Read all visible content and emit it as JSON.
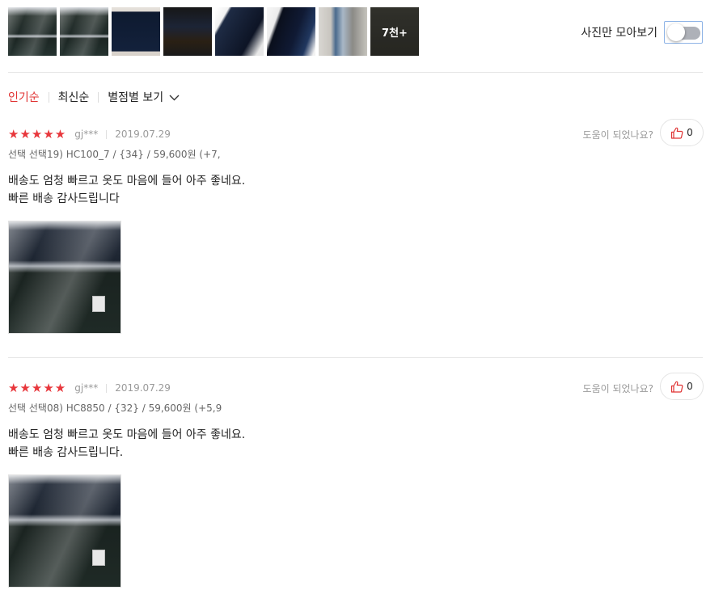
{
  "thumbnails": {
    "items": [
      "photo-1",
      "photo-2",
      "photo-3",
      "photo-4",
      "photo-5",
      "photo-6",
      "photo-7",
      "photo-8"
    ],
    "more_label": "7천+"
  },
  "photo_toggle": {
    "label": "사진만 모아보기",
    "enabled": false
  },
  "sort": {
    "options": [
      "인기순",
      "최신순",
      "별점별 보기"
    ],
    "active": "인기순"
  },
  "reviews": [
    {
      "stars": "★★★★★",
      "rating": 5,
      "user": "gj***",
      "date": "2019.07.29",
      "helpful_label": "도움이 되었나요?",
      "likes": "0",
      "option": "선택 선택19) HC100_7 / {34} / 59,600원 (+7,",
      "body_line1": "배송도 엄청 빠르고 옷도 마음에 들어 아주 좋네요.",
      "body_line2": "빠른 배송 감사드립니다"
    },
    {
      "stars": "★★★★★",
      "rating": 5,
      "user": "gj***",
      "date": "2019.07.29",
      "helpful_label": "도움이 되었나요?",
      "likes": "0",
      "option": "선택 선택08) HC8850 / {32} / 59,600원 (+5,9",
      "body_line1": "배송도 엄청 빠르고 옷도 마음에 들어 아주 좋네요.",
      "body_line2": "빠른 배송 감사드립니다."
    }
  ],
  "colors": {
    "accent": "#e03232",
    "star": "#e8373c",
    "muted": "#9a9a9a",
    "toggle_track": "#aeb1b8"
  },
  "icons": {
    "like": "thumbs-up-icon",
    "sort_dropdown": "chevron-down-icon"
  }
}
